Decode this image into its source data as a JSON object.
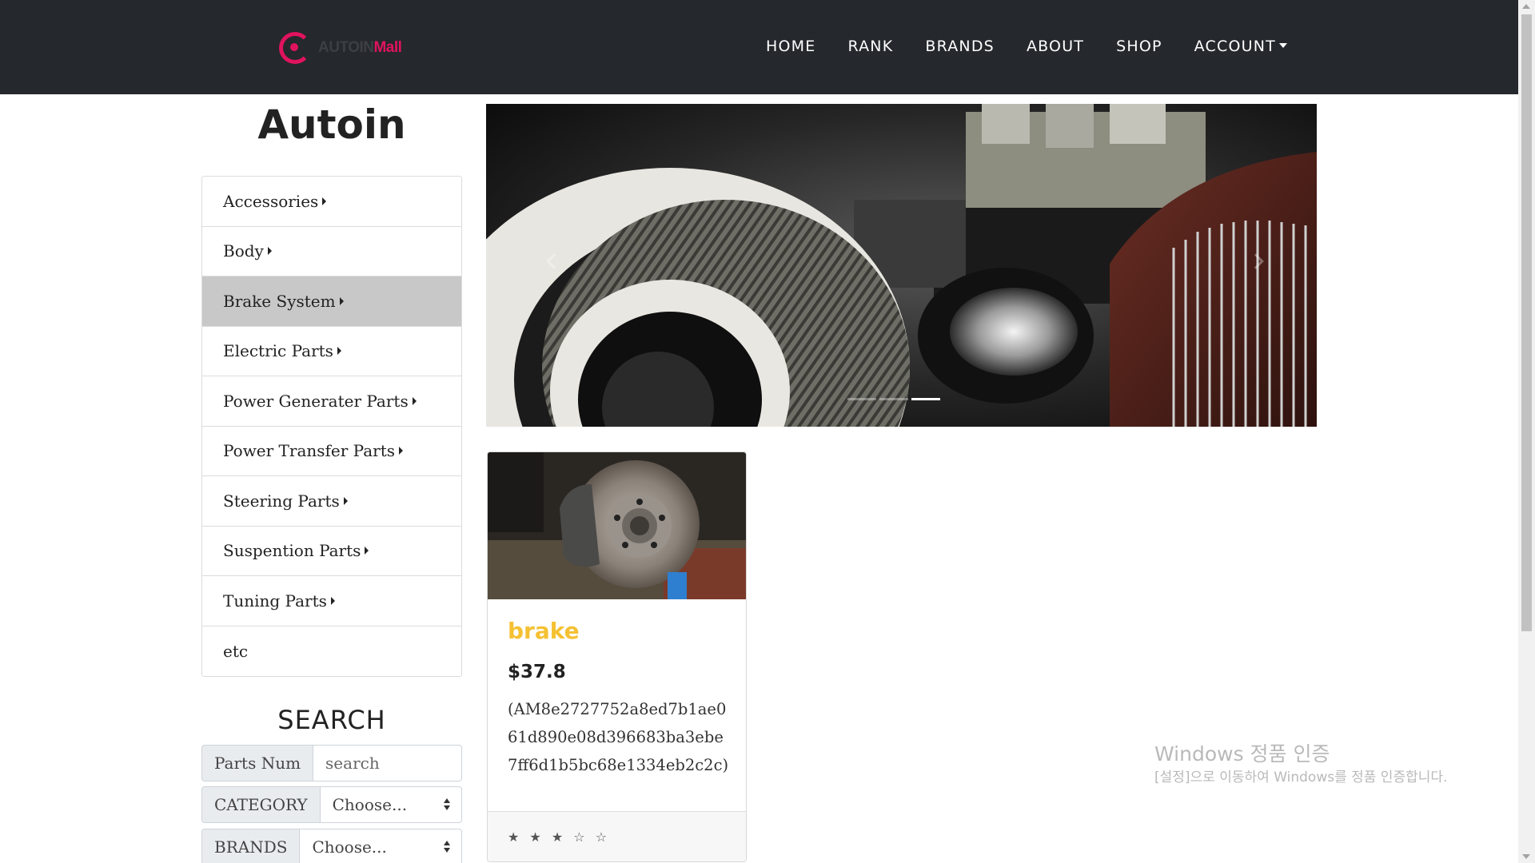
{
  "header": {
    "logo_part1": "AUTOIN",
    "logo_part2": "Mall",
    "nav": [
      "HOME",
      "RANK",
      "BRANDS",
      "ABOUT",
      "SHOP",
      "ACCOUNT"
    ]
  },
  "sidebar": {
    "title": "Autoin",
    "categories": [
      "Accessories",
      "Body",
      "Brake System",
      "Electric Parts",
      "Power Generater Parts",
      "Power Transfer Parts",
      "Steering Parts",
      "Suspention Parts",
      "Tuning Parts",
      "etc"
    ],
    "active_category": "Brake System"
  },
  "search": {
    "title": "SEARCH",
    "parts_label": "Parts Num",
    "parts_placeholder": "search",
    "category_label": "CATEGORY",
    "category_value": "Choose...",
    "brands_label": "BRANDS",
    "brands_value": "Choose..."
  },
  "carousel": {
    "slide_count": 3,
    "active_slide": 3
  },
  "product": {
    "name": "brake",
    "price": "$37.8",
    "code": "(AM8e2727752a8ed7b1ae061d890e08d396683ba3ebe7ff6d1b5bc68e1334eb2c2c)",
    "stars": "★ ★ ★ ☆ ☆",
    "rating": 3
  },
  "watermark": {
    "line1": "Windows 정품 인증",
    "line2": "[설정]으로 이동하여 Windows를 정품 인증합니다."
  },
  "colors": {
    "navbar": "#25282c",
    "brand_accent": "#e0135f",
    "product_title": "#f5c132",
    "active_menu": "#c8c8c8"
  }
}
